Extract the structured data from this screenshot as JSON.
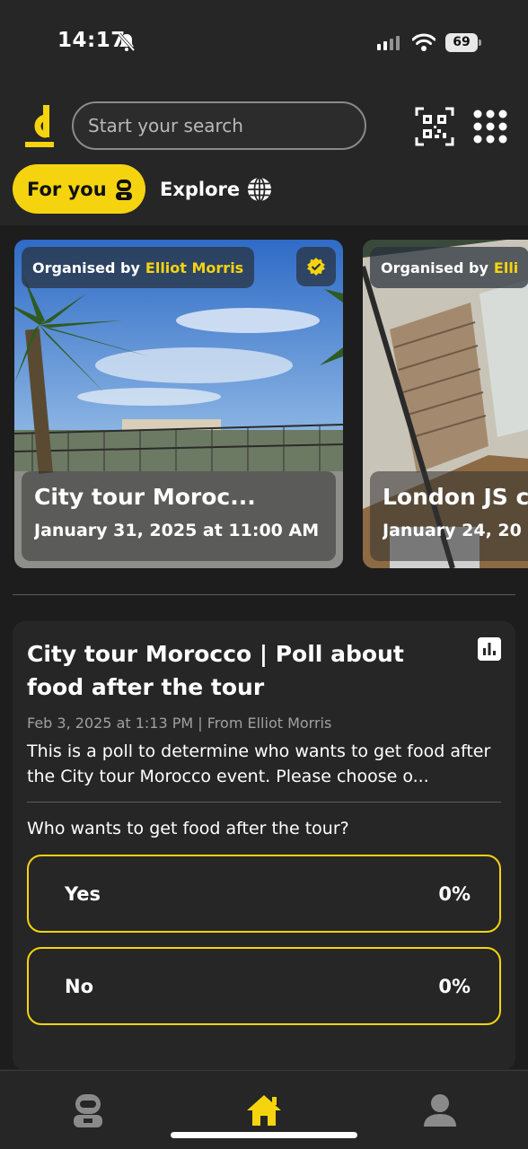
{
  "status_bar": {
    "time": "14:17",
    "battery": "69"
  },
  "header": {
    "search_placeholder": "Start your search"
  },
  "tabs": [
    {
      "label": "For you",
      "active": true
    },
    {
      "label": "Explore",
      "active": false
    }
  ],
  "events": [
    {
      "organiser_prefix": "Organised by",
      "organiser_name": "Elliot Morris",
      "title": "City tour Moroc...",
      "date": "January 31, 2025 at 11:00 AM",
      "verified": true
    },
    {
      "organiser_prefix": "Organised by",
      "organiser_name": "Elli",
      "title": "London JS c",
      "date": "January 24, 20"
    }
  ],
  "poll": {
    "title": "City tour Morocco | Poll about food after the tour",
    "meta": "Feb 3, 2025 at 1:13 PM | From Elliot Morris",
    "description": "This is a poll to determine who wants to get food after the City tour Morocco event. Please choose o...",
    "question": "Who wants to get food after the tour?",
    "options": [
      {
        "label": "Yes",
        "percent": "0%"
      },
      {
        "label": "No",
        "percent": "0%"
      }
    ]
  },
  "colors": {
    "accent": "#f5d40f",
    "background": "#262626",
    "content_bg": "#1d1d1d"
  },
  "icons": {
    "bell": "bell-off-icon",
    "qr": "qr-code-icon",
    "grid": "apps-grid-icon",
    "explore": "globe-icon",
    "foryou": "robot-icon",
    "nav": [
      "robot-icon",
      "home-icon",
      "profile-icon"
    ]
  }
}
